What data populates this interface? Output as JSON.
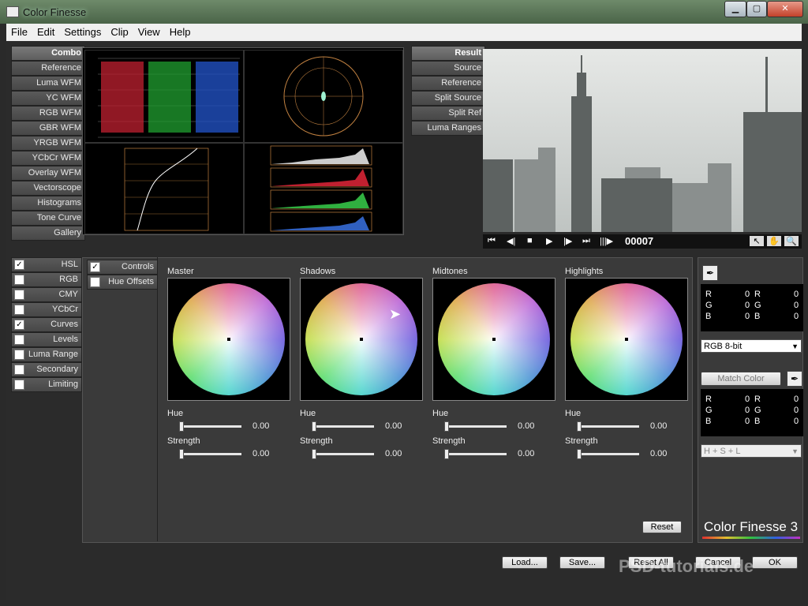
{
  "window": {
    "title": "Color Finesse"
  },
  "menu": [
    "File",
    "Edit",
    "Settings",
    "Clip",
    "View",
    "Help"
  ],
  "scope_modes": [
    "Combo",
    "Reference",
    "Luma WFM",
    "YC WFM",
    "RGB WFM",
    "GBR WFM",
    "YRGB WFM",
    "YCbCr WFM",
    "Overlay WFM",
    "Vectorscope",
    "Histograms",
    "Tone Curve",
    "Gallery"
  ],
  "viewer_modes": [
    "Result",
    "Source",
    "Reference",
    "Split Source",
    "Split Ref",
    "Luma Ranges"
  ],
  "frame_counter": "00007",
  "correction_tabs": [
    {
      "label": "HSL",
      "checked": true
    },
    {
      "label": "RGB",
      "checked": false
    },
    {
      "label": "CMY",
      "checked": false
    },
    {
      "label": "YCbCr",
      "checked": false
    },
    {
      "label": "Curves",
      "checked": true
    },
    {
      "label": "Levels",
      "checked": false
    },
    {
      "label": "Luma Range",
      "checked": false
    },
    {
      "label": "Secondary",
      "checked": false
    },
    {
      "label": "Limiting",
      "checked": false
    }
  ],
  "subtabs": [
    {
      "label": "Controls",
      "checked": true
    },
    {
      "label": "Hue Offsets",
      "checked": false
    }
  ],
  "wheels": [
    {
      "label": "Master",
      "hue_label": "Hue",
      "hue": "0.00",
      "strength_label": "Strength",
      "strength": "0.00"
    },
    {
      "label": "Shadows",
      "hue_label": "Hue",
      "hue": "0.00",
      "strength_label": "Strength",
      "strength": "0.00"
    },
    {
      "label": "Midtones",
      "hue_label": "Hue",
      "hue": "0.00",
      "strength_label": "Strength",
      "strength": "0.00"
    },
    {
      "label": "Highlights",
      "hue_label": "Hue",
      "hue": "0.00",
      "strength_label": "Strength",
      "strength": "0.00"
    }
  ],
  "reset_label": "Reset",
  "info1": {
    "rows": [
      [
        "R",
        "0",
        "R",
        "0"
      ],
      [
        "G",
        "0",
        "G",
        "0"
      ],
      [
        "B",
        "0",
        "B",
        "0"
      ]
    ]
  },
  "bitdepth": "RGB 8-bit",
  "match_color_label": "Match Color",
  "info2": {
    "rows": [
      [
        "R",
        "0",
        "R",
        "0"
      ],
      [
        "G",
        "0",
        "G",
        "0"
      ],
      [
        "B",
        "0",
        "B",
        "0"
      ]
    ]
  },
  "match_mode": "H + S + L",
  "logo": "Color Finesse 3",
  "bottom_buttons": [
    "Load...",
    "Save...",
    "Reset All",
    "Cancel",
    "OK"
  ],
  "watermark": "PSD-tutorials.de",
  "colors": {
    "panel": "#3a3a3a",
    "button": "#4f4f4f",
    "accent": "#e08040"
  }
}
